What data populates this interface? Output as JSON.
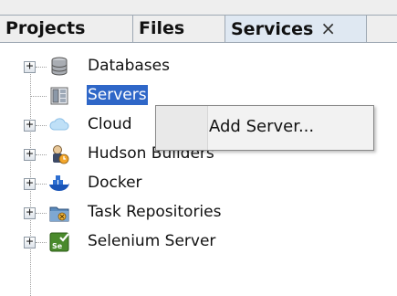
{
  "tabs": {
    "projects": "Projects",
    "files": "Files",
    "services": "Services",
    "close_glyph": "×"
  },
  "tree": {
    "items": [
      {
        "label": "Databases",
        "icon": "database-icon",
        "expandable": true
      },
      {
        "label": "Servers",
        "icon": "server-icon",
        "expandable": false,
        "selected": true
      },
      {
        "label": "Cloud",
        "icon": "cloud-icon",
        "expandable": true
      },
      {
        "label": "Hudson Builders",
        "icon": "hudson-builders-icon",
        "expandable": true
      },
      {
        "label": "Docker",
        "icon": "docker-icon",
        "expandable": true
      },
      {
        "label": "Task Repositories",
        "icon": "task-repository-icon",
        "expandable": true
      },
      {
        "label": "Selenium Server",
        "icon": "selenium-icon",
        "expandable": true
      }
    ],
    "expander_glyph": "+"
  },
  "context_menu": {
    "items": [
      {
        "label": "Add Server..."
      }
    ]
  },
  "colors": {
    "selection": "#2f67c8",
    "active_tab": "#dfe8f2",
    "tab_border": "#9ea8b3",
    "menu_background": "#f2f2f2"
  }
}
